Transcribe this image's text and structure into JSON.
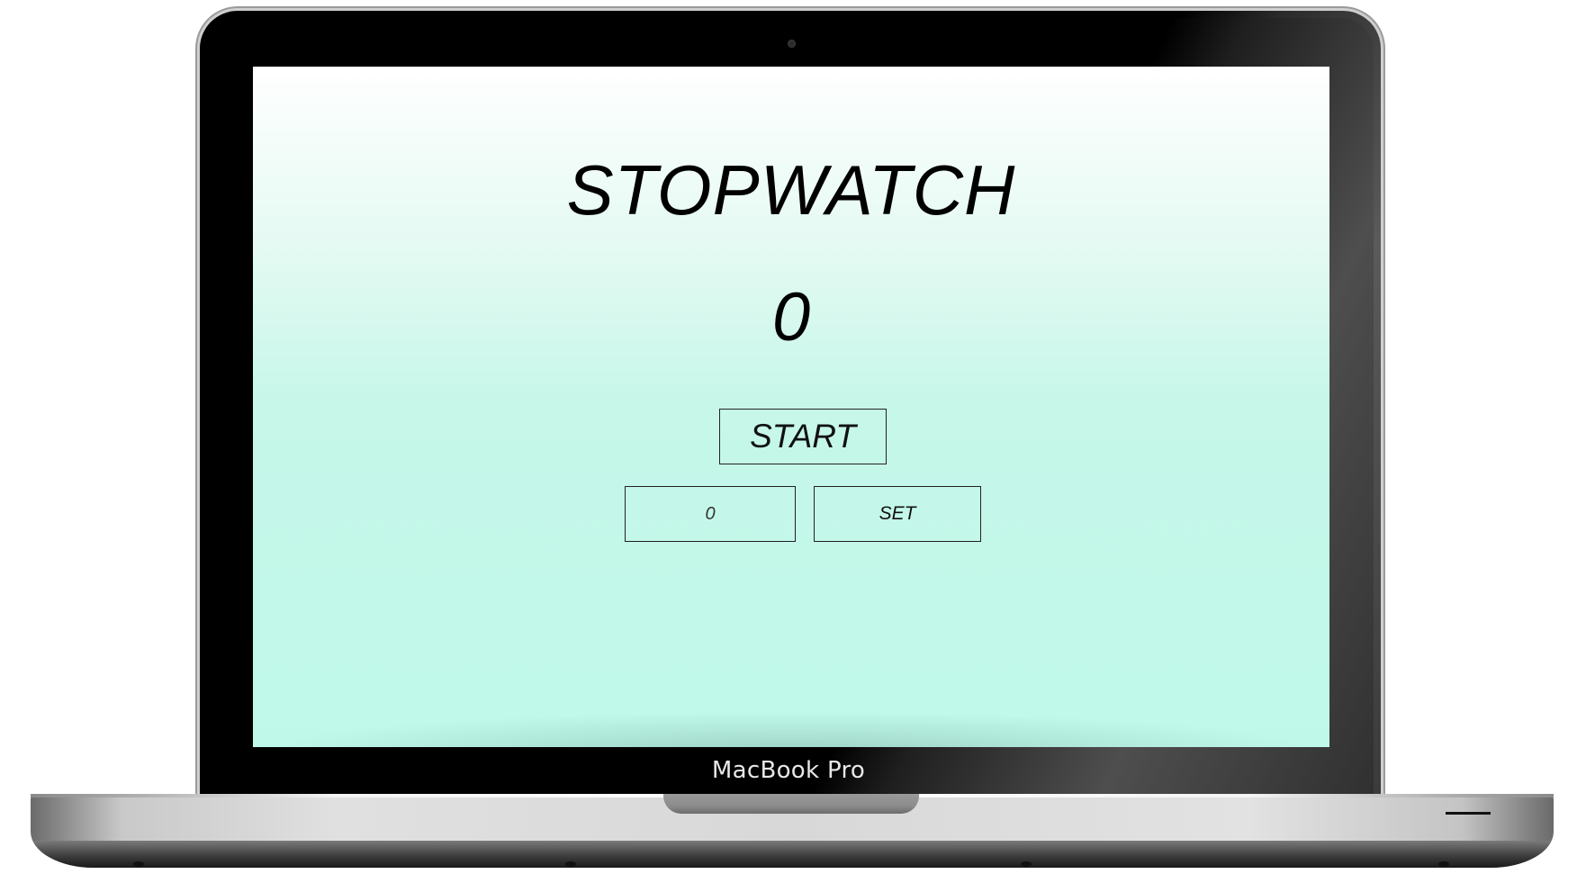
{
  "device": {
    "label": "MacBook Pro"
  },
  "app": {
    "title": "STOPWATCH",
    "display_value": "0",
    "start_label": "START",
    "time_input": {
      "value": "",
      "placeholder": "0"
    },
    "set_label": "SET"
  },
  "colors": {
    "screen_gradient_top": "#ffffff",
    "screen_gradient_bottom": "#bff8e9",
    "text": "#000000",
    "button_border": "#222222"
  }
}
